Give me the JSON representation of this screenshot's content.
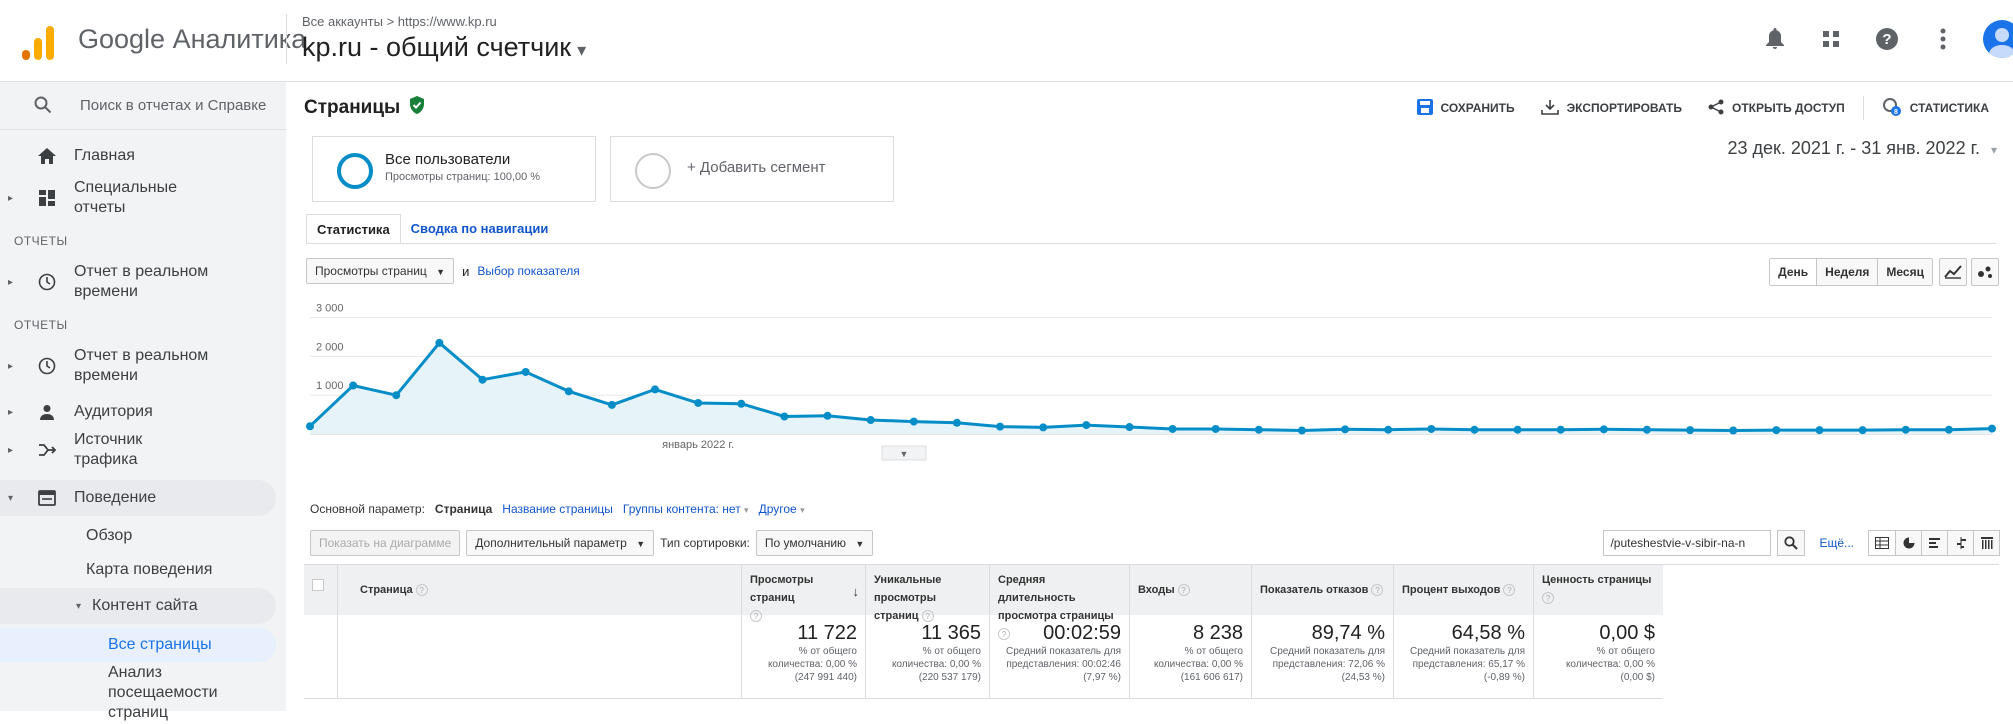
{
  "header": {
    "app_title": "Google Аналитика",
    "breadcrumb": "Все аккаунты > https://www.kp.ru",
    "account_name": "kp.ru - общий счетчик",
    "colors": {
      "logo_orange": "#f9ab00",
      "logo_dark": "#e37400",
      "accent": "#1a73e8"
    }
  },
  "sidebar": {
    "search_placeholder": "Поиск в отчетах и Справке",
    "home": "Главная",
    "custom_reports": "Специальные отчеты",
    "section_reports_1": "ОТЧЕТЫ",
    "realtime_1": "Отчет в реальном времени",
    "section_reports_2": "ОТЧЕТЫ",
    "realtime_2": "Отчет в реальном времени",
    "audience": "Аудитория",
    "acquisition": "Источник трафика",
    "behavior": "Поведение",
    "overview": "Обзор",
    "behavior_flow": "Карта поведения",
    "site_content": "Контент сайта",
    "all_pages": "Все страницы",
    "content_drilldown": "Анализ посещаемости страниц"
  },
  "main": {
    "page_title": "Страницы",
    "toolbar": {
      "save": "СОХРАНИТЬ",
      "export": "ЭКСПОРТИРОВАТЬ",
      "share": "ОТКРЫТЬ ДОСТУП",
      "insights": "СТАТИСТИКА"
    },
    "segment": {
      "name": "Все пользователи",
      "sub": "Просмотры страниц: 100,00 %",
      "add": "+ Добавить сегмент"
    },
    "date_range": "23 дек. 2021 г. - 31 янв. 2022 г.",
    "tabs": [
      "Статистика",
      "Сводка по навигации"
    ],
    "metric_select": "Просмотры страниц",
    "and_text": "и",
    "choose_metric": "Выбор показателя",
    "granularity": [
      "День",
      "Неделя",
      "Месяц"
    ]
  },
  "chart_data": {
    "type": "area",
    "series": [
      {
        "values": [
          200,
          1250,
          1000,
          2350,
          1400,
          1600,
          1100,
          750,
          1150,
          800,
          780,
          450,
          470,
          360,
          320,
          290,
          190,
          170,
          230,
          180,
          130,
          130,
          110,
          90,
          120,
          110,
          130,
          110,
          110,
          110,
          120,
          110,
          100,
          90,
          100,
          100,
          100,
          110,
          110,
          140
        ]
      }
    ],
    "x_tick_label": "январь 2022 г.",
    "yticks": [
      1000,
      2000,
      3000
    ],
    "ytick_labels": [
      "1 000",
      "2 000",
      "3 000"
    ],
    "ylim": [
      0,
      3300
    ],
    "color": "#058dc7",
    "fill": "#e6f3f9",
    "grid": true
  },
  "table": {
    "dim_label": "Основной параметр:",
    "dim_active": "Страница",
    "dim_options": [
      "Название страницы",
      "Группы контента: нет",
      "Другое"
    ],
    "plot_rows": "Показать на диаграмме",
    "secondary_dim": "Дополнительный параметр",
    "sort_label": "Тип сортировки:",
    "sort_value": "По умолчанию",
    "filter_value": "/puteshestvie-v-sibir-na-n",
    "more": "Ещё...",
    "columns": [
      "Страница",
      "Просмотры страниц",
      "Уникальные просмотры страниц",
      "Средняя длительность просмотра страницы",
      "Входы",
      "Показатель отказов",
      "Процент выходов",
      "Ценность страницы"
    ],
    "totals": [
      {
        "value": "11 722",
        "sub": "% от общего количества: 0,00 % (247 991 440)"
      },
      {
        "value": "11 365",
        "sub": "% от общего количества: 0,00 % (220 537 179)"
      },
      {
        "value": "00:02:59",
        "sub": "Средний показатель для представления: 00:02:46 (7,97 %)"
      },
      {
        "value": "8 238",
        "sub": "% от общего количества: 0,00 % (161 606 617)"
      },
      {
        "value": "89,74 %",
        "sub": "Средний показатель для представления: 72,06 % (24,53 %)"
      },
      {
        "value": "64,58 %",
        "sub": "Средний показатель для представления: 65,17 % (-0,89 %)"
      },
      {
        "value": "0,00 $",
        "sub": "% от общего количества: 0,00 % (0,00 $)"
      }
    ]
  }
}
